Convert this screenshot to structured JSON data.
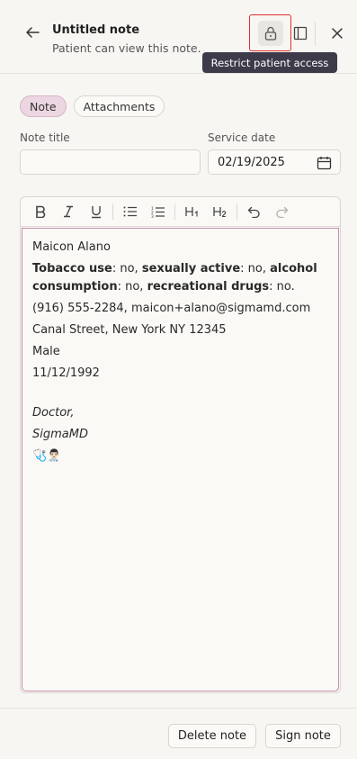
{
  "header": {
    "title": "Untitled note",
    "subtitle": "Patient can view this note.",
    "tooltip": "Restrict patient access",
    "icons": {
      "back": "arrow-left-icon",
      "lock": "lock-icon",
      "panel": "sidebar-panel-icon",
      "close": "close-icon"
    }
  },
  "tabs": [
    {
      "label": "Note",
      "active": true
    },
    {
      "label": "Attachments",
      "active": false
    }
  ],
  "form": {
    "note_title_label": "Note title",
    "note_title_value": "",
    "service_date_label": "Service date",
    "service_date_value": "02/19/2025"
  },
  "toolbar": {
    "bold": "B",
    "italic": "I",
    "underline": "U",
    "h1": "H1",
    "h2": "H2"
  },
  "note": {
    "name": "Maicon Alano",
    "tobacco_label": "Tobacco use",
    "tobacco_value": ": no, ",
    "sexual_label": "sexually active",
    "sexual_value": ": no, ",
    "alcohol_label": "alcohol consumption",
    "alcohol_value": ": no, ",
    "drugs_label": "recreational drugs",
    "drugs_value": ": no.",
    "contact": "(916) 555-2284, maicon+alano@sigmamd.com",
    "address": "Canal Street, New York NY 12345",
    "sex": "Male",
    "dob": "11/12/1992",
    "signature_title": "Doctor,",
    "signature_org": "SigmaMD",
    "signature_emoji": "🩺👨🏻‍⚕️"
  },
  "footer": {
    "delete_label": "Delete note",
    "sign_label": "Sign note"
  },
  "colors": {
    "accent_tab": "#ecd6e2",
    "editor_focus": "#c98cae",
    "highlight_box": "#e0302a",
    "tooltip_bg": "#3d3b4a"
  }
}
